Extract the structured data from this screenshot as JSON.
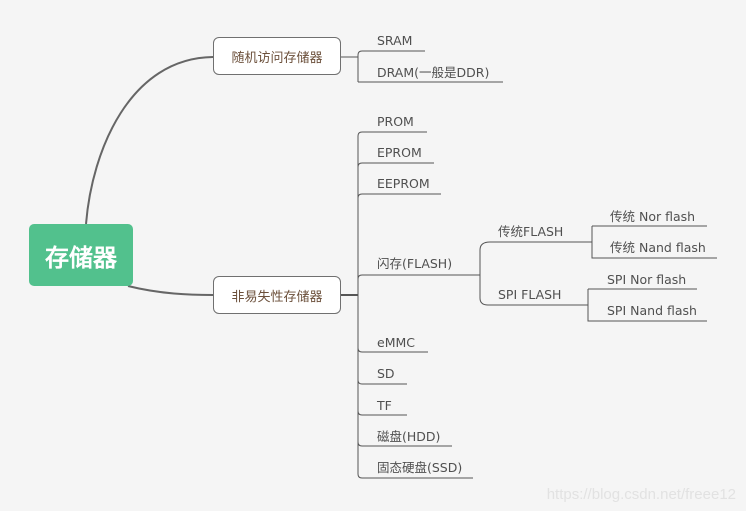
{
  "root": {
    "label": "存储器",
    "color": "#52c18d"
  },
  "branches": [
    {
      "label": "随机访问存储器",
      "children": [
        {
          "label": "SRAM"
        },
        {
          "label": "DRAM(一般是DDR)"
        }
      ]
    },
    {
      "label": "非易失性存储器",
      "children": [
        {
          "label": "PROM"
        },
        {
          "label": "EPROM"
        },
        {
          "label": "EEPROM"
        },
        {
          "label": "闪存(FLASH)",
          "children": [
            {
              "label": "传统FLASH",
              "children": [
                {
                  "label": "传统 Nor flash"
                },
                {
                  "label": "传统 Nand flash"
                }
              ]
            },
            {
              "label": "SPI FLASH",
              "children": [
                {
                  "label": "SPI Nor flash"
                },
                {
                  "label": "SPI Nand flash"
                }
              ]
            }
          ]
        },
        {
          "label": "eMMC"
        },
        {
          "label": "SD"
        },
        {
          "label": "TF"
        },
        {
          "label": "磁盘(HDD)"
        },
        {
          "label": "固态硬盘(SSD)"
        }
      ]
    }
  ],
  "watermark": "https://blog.csdn.net/freee12"
}
